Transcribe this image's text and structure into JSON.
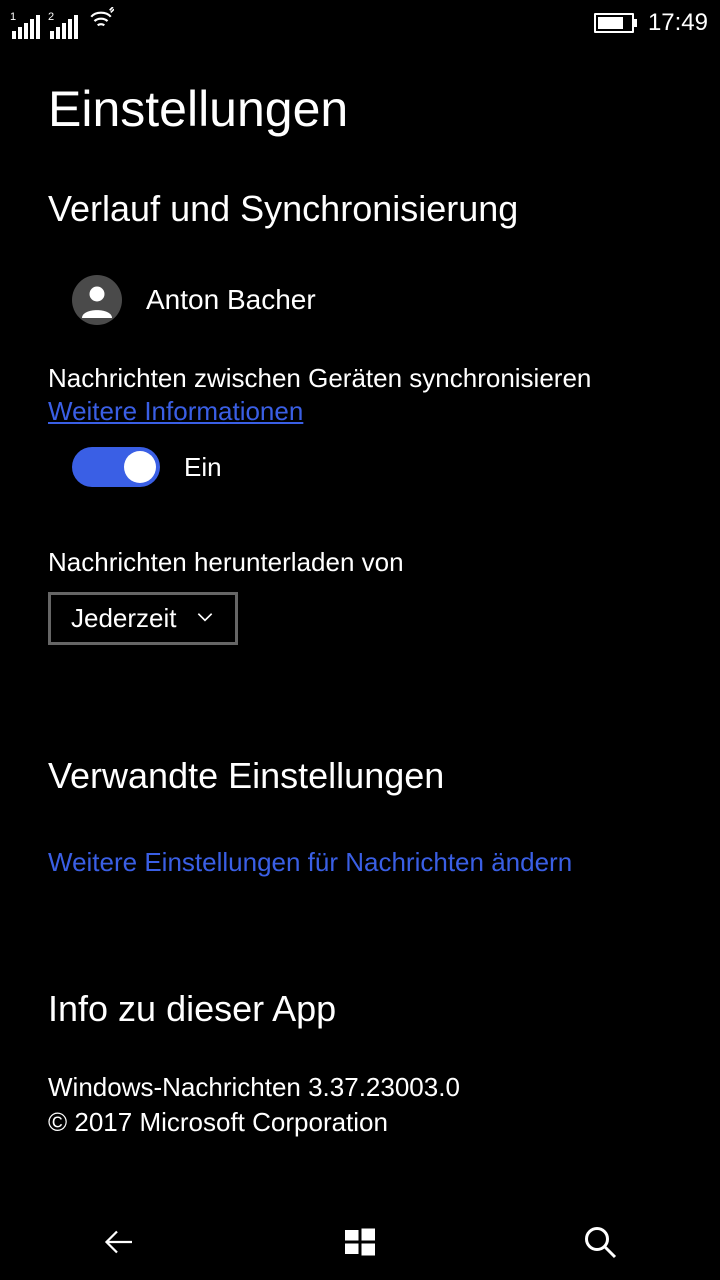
{
  "statusbar": {
    "sim1": "1",
    "sim2": "2",
    "time": "17:49"
  },
  "page": {
    "title": "Einstellungen"
  },
  "section_history": {
    "title": "Verlauf und Synchronisierung",
    "user_name": "Anton Bacher",
    "sync_text": "Nachrichten zwischen Geräten synchronisieren",
    "more_info": "Weitere Informationen",
    "toggle_label": "Ein",
    "download_label": "Nachrichten herunterladen von",
    "download_value": "Jederzeit"
  },
  "section_related": {
    "title": "Verwandte Einstellungen",
    "link": "Weitere Einstellungen für Nachrichten ändern"
  },
  "section_about": {
    "title": "Info zu dieser App",
    "app_line": "Windows-Nachrichten 3.37.23003.0",
    "copyright": "© 2017 Microsoft Corporation"
  }
}
